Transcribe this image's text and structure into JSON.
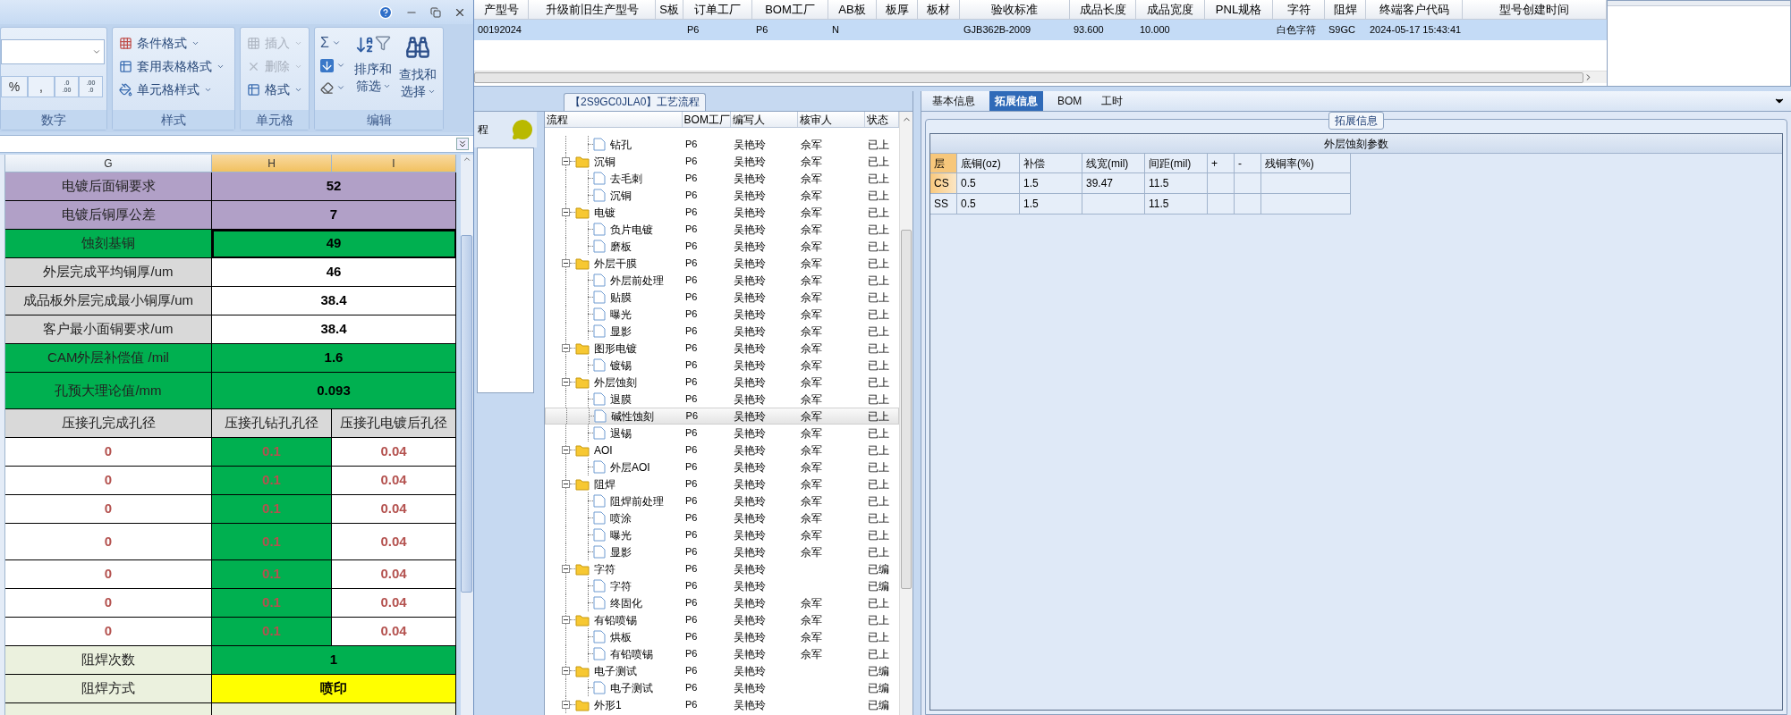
{
  "excel": {
    "ribbon": {
      "number_group": {
        "label": "数字",
        "buttons": [
          "%",
          ","
        ],
        "decimal_buttons": [
          [
            ".0",
            ".00"
          ],
          [
            ".00",
            ".0"
          ]
        ]
      },
      "styles_group": {
        "label": "样式",
        "items": [
          {
            "kind": "conditional",
            "label": "条件格式"
          },
          {
            "kind": "table",
            "label": "套用表格格式"
          },
          {
            "kind": "cell_style",
            "label": "单元格样式"
          }
        ]
      },
      "cells_group": {
        "label": "单元格",
        "items": [
          {
            "kind": "insert",
            "label": "插入",
            "disabled": true
          },
          {
            "kind": "delete",
            "label": "删除",
            "disabled": true
          },
          {
            "kind": "format",
            "label": "格式",
            "disabled": false
          }
        ]
      },
      "editing_group": {
        "label": "编辑",
        "small": [
          {
            "kind": "sum",
            "symbol": "Σ"
          },
          {
            "kind": "fill"
          },
          {
            "kind": "clear"
          }
        ],
        "big": [
          {
            "kind": "sort",
            "lines": [
              "排序和",
              "筛选"
            ]
          },
          {
            "kind": "find",
            "lines": [
              "查找和",
              "选择"
            ]
          }
        ]
      }
    },
    "columns": [
      {
        "label": "G",
        "selected": false
      },
      {
        "label": "H",
        "selected": true
      },
      {
        "label": "I",
        "selected": true
      }
    ],
    "rows": [
      {
        "tall": false,
        "cells": [
          {
            "text": "电镀后面铜要求",
            "kind": "label",
            "color": "#b1a0c7",
            "selected": false
          },
          {
            "text": "52",
            "kind": "value",
            "color": "#b1a0c7",
            "selected": false
          }
        ]
      },
      {
        "tall": false,
        "cells": [
          {
            "text": "电镀后铜厚公差",
            "kind": "label",
            "color": "#b1a0c7",
            "selected": false
          },
          {
            "text": "7",
            "kind": "value",
            "color": "#b1a0c7",
            "selected": false
          }
        ]
      },
      {
        "tall": false,
        "cells": [
          {
            "text": "蚀刻基铜",
            "kind": "label",
            "color": "#00b050",
            "selected": false
          },
          {
            "text": "49",
            "kind": "value",
            "color": "#00b050",
            "selected": true
          }
        ]
      },
      {
        "tall": false,
        "cells": [
          {
            "text": "外层完成平均铜厚/um",
            "kind": "label",
            "color": "#d9d9d9",
            "selected": false
          },
          {
            "text": "46",
            "kind": "value",
            "color": "#ffffff",
            "selected": false
          }
        ]
      },
      {
        "tall": false,
        "cells": [
          {
            "text": "成品板外层完成最小铜厚/um",
            "kind": "label",
            "color": "#d9d9d9",
            "selected": false
          },
          {
            "text": "38.4",
            "kind": "value",
            "color": "#ffffff",
            "selected": false
          }
        ]
      },
      {
        "tall": false,
        "cells": [
          {
            "text": "客户最小面铜要求/um",
            "kind": "label",
            "color": "#d9d9d9",
            "selected": false
          },
          {
            "text": "38.4",
            "kind": "value",
            "color": "#ffffff",
            "selected": false
          }
        ]
      },
      {
        "tall": false,
        "cells": [
          {
            "text": "CAM外层补偿值 /mil",
            "kind": "label",
            "color": "#00b050",
            "selected": false
          },
          {
            "text": "1.6",
            "kind": "value",
            "color": "#00b050",
            "selected": false
          }
        ]
      },
      {
        "tall": true,
        "cells": [
          {
            "text": "孔预大理论值/mm",
            "kind": "label",
            "color": "#00b050",
            "selected": false
          },
          {
            "text": "0.093",
            "kind": "value",
            "color": "#00b050",
            "selected": false
          }
        ]
      },
      {
        "tall": false,
        "cells": [
          {
            "text": "压接孔完成孔径",
            "kind": "label",
            "color": "#d9d9d9",
            "selected": false
          },
          {
            "text": "压接孔钻孔孔径",
            "kind": "label",
            "color": "#d9d9d9",
            "selected": false
          },
          {
            "text": "压接孔电镀后孔径",
            "kind": "label",
            "color": "#d9d9d9",
            "selected": false
          }
        ]
      },
      {
        "tall": false,
        "cells": [
          {
            "text": "0",
            "kind": "alert",
            "color": "#ffffff",
            "selected": false
          },
          {
            "text": "0.1",
            "kind": "alert",
            "color": "#00b050",
            "selected": false
          },
          {
            "text": "0.04",
            "kind": "alert",
            "color": "#ffffff",
            "selected": false
          }
        ]
      },
      {
        "tall": false,
        "cells": [
          {
            "text": "0",
            "kind": "alert",
            "color": "#ffffff",
            "selected": false
          },
          {
            "text": "0.1",
            "kind": "alert",
            "color": "#00b050",
            "selected": false
          },
          {
            "text": "0.04",
            "kind": "alert",
            "color": "#ffffff",
            "selected": false
          }
        ]
      },
      {
        "tall": false,
        "cells": [
          {
            "text": "0",
            "kind": "alert",
            "color": "#ffffff",
            "selected": false
          },
          {
            "text": "0.1",
            "kind": "alert",
            "color": "#00b050",
            "selected": false
          },
          {
            "text": "0.04",
            "kind": "alert",
            "color": "#ffffff",
            "selected": false
          }
        ]
      },
      {
        "tall": true,
        "cells": [
          {
            "text": "0",
            "kind": "alert",
            "color": "#ffffff",
            "selected": false
          },
          {
            "text": "0.1",
            "kind": "alert",
            "color": "#00b050",
            "selected": false
          },
          {
            "text": "0.04",
            "kind": "alert",
            "color": "#ffffff",
            "selected": false
          }
        ]
      },
      {
        "tall": false,
        "cells": [
          {
            "text": "0",
            "kind": "alert",
            "color": "#ffffff",
            "selected": false
          },
          {
            "text": "0.1",
            "kind": "alert",
            "color": "#00b050",
            "selected": false
          },
          {
            "text": "0.04",
            "kind": "alert",
            "color": "#ffffff",
            "selected": false
          }
        ]
      },
      {
        "tall": false,
        "cells": [
          {
            "text": "0",
            "kind": "alert",
            "color": "#ffffff",
            "selected": false
          },
          {
            "text": "0.1",
            "kind": "alert",
            "color": "#00b050",
            "selected": false
          },
          {
            "text": "0.04",
            "kind": "alert",
            "color": "#ffffff",
            "selected": false
          }
        ]
      },
      {
        "tall": false,
        "cells": [
          {
            "text": "0",
            "kind": "alert",
            "color": "#ffffff",
            "selected": false
          },
          {
            "text": "0.1",
            "kind": "alert",
            "color": "#00b050",
            "selected": false
          },
          {
            "text": "0.04",
            "kind": "alert",
            "color": "#ffffff",
            "selected": false
          }
        ]
      },
      {
        "tall": false,
        "cells": [
          {
            "text": "阻焊次数",
            "kind": "label",
            "color": "#ebf1de",
            "selected": false
          },
          {
            "text": "1",
            "kind": "value",
            "color": "#00b050",
            "selected": false
          }
        ]
      },
      {
        "tall": false,
        "cells": [
          {
            "text": "阻焊方式",
            "kind": "label",
            "color": "#ebf1de",
            "selected": false
          },
          {
            "text": "喷印",
            "kind": "value",
            "color": "#ffff00",
            "selected": false
          }
        ]
      }
    ]
  },
  "main_table": {
    "columns": [
      "产型号",
      "升级前旧生产型号",
      "S板",
      "订单工厂",
      "BOM工厂",
      "AB板",
      "板厚",
      "板材",
      "验收标准",
      "成品长度",
      "成品宽度",
      "PNL规格",
      "字符",
      "阻焊",
      "终端客户代码",
      "型号创建时间"
    ],
    "rows": [
      {
        "selected": true,
        "cells": [
          "00192024",
          null,
          null,
          "P6",
          "P6",
          "N",
          null,
          null,
          "GJB362B-2009",
          "93.600",
          "10.000",
          null,
          "白色字符",
          "S9GC",
          "2024-05-17 15:43:41"
        ]
      }
    ]
  },
  "process_panel": {
    "side_label": "程",
    "title": "【2S9GC0JLA0】工艺流程",
    "columns": [
      "流程",
      "BOM工厂",
      "编写人",
      "核审人",
      "状态"
    ],
    "tree": [
      {
        "children": [
          {
            "label": "钻孔",
            "factory": "P6",
            "writer": "吴艳玲",
            "reviewer": "佘军",
            "status": "已上",
            "selected": false
          }
        ]
      },
      {
        "label": "沉铜",
        "factory": "P6",
        "writer": "吴艳玲",
        "reviewer": "佘军",
        "status": "已上",
        "selected": false,
        "expanded": true,
        "children": [
          {
            "label": "去毛刺",
            "factory": "P6",
            "writer": "吴艳玲",
            "reviewer": "佘军",
            "status": "已上",
            "selected": false
          },
          {
            "label": "沉铜",
            "factory": "P6",
            "writer": "吴艳玲",
            "reviewer": "佘军",
            "status": "已上",
            "selected": false
          }
        ]
      },
      {
        "label": "电镀",
        "factory": "P6",
        "writer": "吴艳玲",
        "reviewer": "佘军",
        "status": "已上",
        "selected": false,
        "expanded": true,
        "children": [
          {
            "label": "负片电镀",
            "factory": "P6",
            "writer": "吴艳玲",
            "reviewer": "佘军",
            "status": "已上",
            "selected": false
          },
          {
            "label": "磨板",
            "factory": "P6",
            "writer": "吴艳玲",
            "reviewer": "佘军",
            "status": "已上",
            "selected": false
          }
        ]
      },
      {
        "label": "外层干膜",
        "factory": "P6",
        "writer": "吴艳玲",
        "reviewer": "佘军",
        "status": "已上",
        "selected": false,
        "expanded": true,
        "children": [
          {
            "label": "外层前处理",
            "factory": "P6",
            "writer": "吴艳玲",
            "reviewer": "佘军",
            "status": "已上",
            "selected": false
          },
          {
            "label": "贴膜",
            "factory": "P6",
            "writer": "吴艳玲",
            "reviewer": "佘军",
            "status": "已上",
            "selected": false
          },
          {
            "label": "曝光",
            "factory": "P6",
            "writer": "吴艳玲",
            "reviewer": "佘军",
            "status": "已上",
            "selected": false
          },
          {
            "label": "显影",
            "factory": "P6",
            "writer": "吴艳玲",
            "reviewer": "佘军",
            "status": "已上",
            "selected": false
          }
        ]
      },
      {
        "label": "图形电镀",
        "factory": "P6",
        "writer": "吴艳玲",
        "reviewer": "佘军",
        "status": "已上",
        "selected": false,
        "expanded": true,
        "children": [
          {
            "label": "镀锡",
            "factory": "P6",
            "writer": "吴艳玲",
            "reviewer": "佘军",
            "status": "已上",
            "selected": false
          }
        ]
      },
      {
        "label": "外层蚀刻",
        "factory": "P6",
        "writer": "吴艳玲",
        "reviewer": "佘军",
        "status": "已上",
        "selected": false,
        "expanded": true,
        "children": [
          {
            "label": "退膜",
            "factory": "P6",
            "writer": "吴艳玲",
            "reviewer": "佘军",
            "status": "已上",
            "selected": false
          },
          {
            "label": "碱性蚀刻",
            "factory": "P6",
            "writer": "吴艳玲",
            "reviewer": "佘军",
            "status": "已上",
            "selected": true
          },
          {
            "label": "退锡",
            "factory": "P6",
            "writer": "吴艳玲",
            "reviewer": "佘军",
            "status": "已上",
            "selected": false
          }
        ]
      },
      {
        "label": "AOI",
        "factory": "P6",
        "writer": "吴艳玲",
        "reviewer": "佘军",
        "status": "已上",
        "selected": false,
        "expanded": true,
        "children": [
          {
            "label": "外层AOI",
            "factory": "P6",
            "writer": "吴艳玲",
            "reviewer": "佘军",
            "status": "已上",
            "selected": false
          }
        ]
      },
      {
        "label": "阻焊",
        "factory": "P6",
        "writer": "吴艳玲",
        "reviewer": "佘军",
        "status": "已上",
        "selected": false,
        "expanded": true,
        "children": [
          {
            "label": "阻焊前处理",
            "factory": "P6",
            "writer": "吴艳玲",
            "reviewer": "佘军",
            "status": "已上",
            "selected": false
          },
          {
            "label": "喷涂",
            "factory": "P6",
            "writer": "吴艳玲",
            "reviewer": "佘军",
            "status": "已上",
            "selected": false
          },
          {
            "label": "曝光",
            "factory": "P6",
            "writer": "吴艳玲",
            "reviewer": "佘军",
            "status": "已上",
            "selected": false
          },
          {
            "label": "显影",
            "factory": "P6",
            "writer": "吴艳玲",
            "reviewer": "佘军",
            "status": "已上",
            "selected": false
          }
        ]
      },
      {
        "label": "字符",
        "factory": "P6",
        "writer": "吴艳玲",
        "status": "已编",
        "selected": false,
        "expanded": true,
        "children": [
          {
            "label": "字符",
            "factory": "P6",
            "writer": "吴艳玲",
            "status": "已编",
            "selected": false
          },
          {
            "label": "终固化",
            "factory": "P6",
            "writer": "吴艳玲",
            "reviewer": "佘军",
            "status": "已上",
            "selected": false
          }
        ]
      },
      {
        "label": "有铅喷锡",
        "factory": "P6",
        "writer": "吴艳玲",
        "reviewer": "佘军",
        "status": "已上",
        "selected": false,
        "expanded": true,
        "children": [
          {
            "label": "烘板",
            "factory": "P6",
            "writer": "吴艳玲",
            "reviewer": "佘军",
            "status": "已上",
            "selected": false
          },
          {
            "label": "有铅喷锡",
            "factory": "P6",
            "writer": "吴艳玲",
            "reviewer": "佘军",
            "status": "已上",
            "selected": false
          }
        ]
      },
      {
        "label": "电子测试",
        "factory": "P6",
        "writer": "吴艳玲",
        "status": "已编",
        "selected": false,
        "expanded": true,
        "children": [
          {
            "label": "电子测试",
            "factory": "P6",
            "writer": "吴艳玲",
            "status": "已编",
            "selected": false
          }
        ]
      },
      {
        "label": "外形1",
        "factory": "P6",
        "writer": "吴艳玲",
        "status": "已编",
        "selected": false,
        "expanded": true
      }
    ]
  },
  "detail_panel": {
    "tabs": [
      {
        "label": "基本信息",
        "selected": false
      },
      {
        "label": "拓展信息",
        "selected": true
      },
      {
        "label": "BOM",
        "selected": false
      },
      {
        "label": "工时",
        "selected": false
      }
    ],
    "group_title": "拓展信息",
    "table": {
      "title": "外层蚀刻参数",
      "columns": [
        "层",
        "底铜(oz)",
        "补偿",
        "线宽(mil)",
        "间距(mil)",
        "+",
        "-",
        "残铜率(%)"
      ],
      "rows": [
        {
          "selected": true,
          "cells": [
            "CS",
            "0.5",
            "1.5",
            "39.47",
            "11.5",
            null,
            null,
            null
          ]
        },
        {
          "selected": false,
          "cells": [
            "SS",
            "0.5",
            "1.5",
            null,
            "11.5",
            null,
            null,
            null
          ]
        }
      ]
    }
  }
}
